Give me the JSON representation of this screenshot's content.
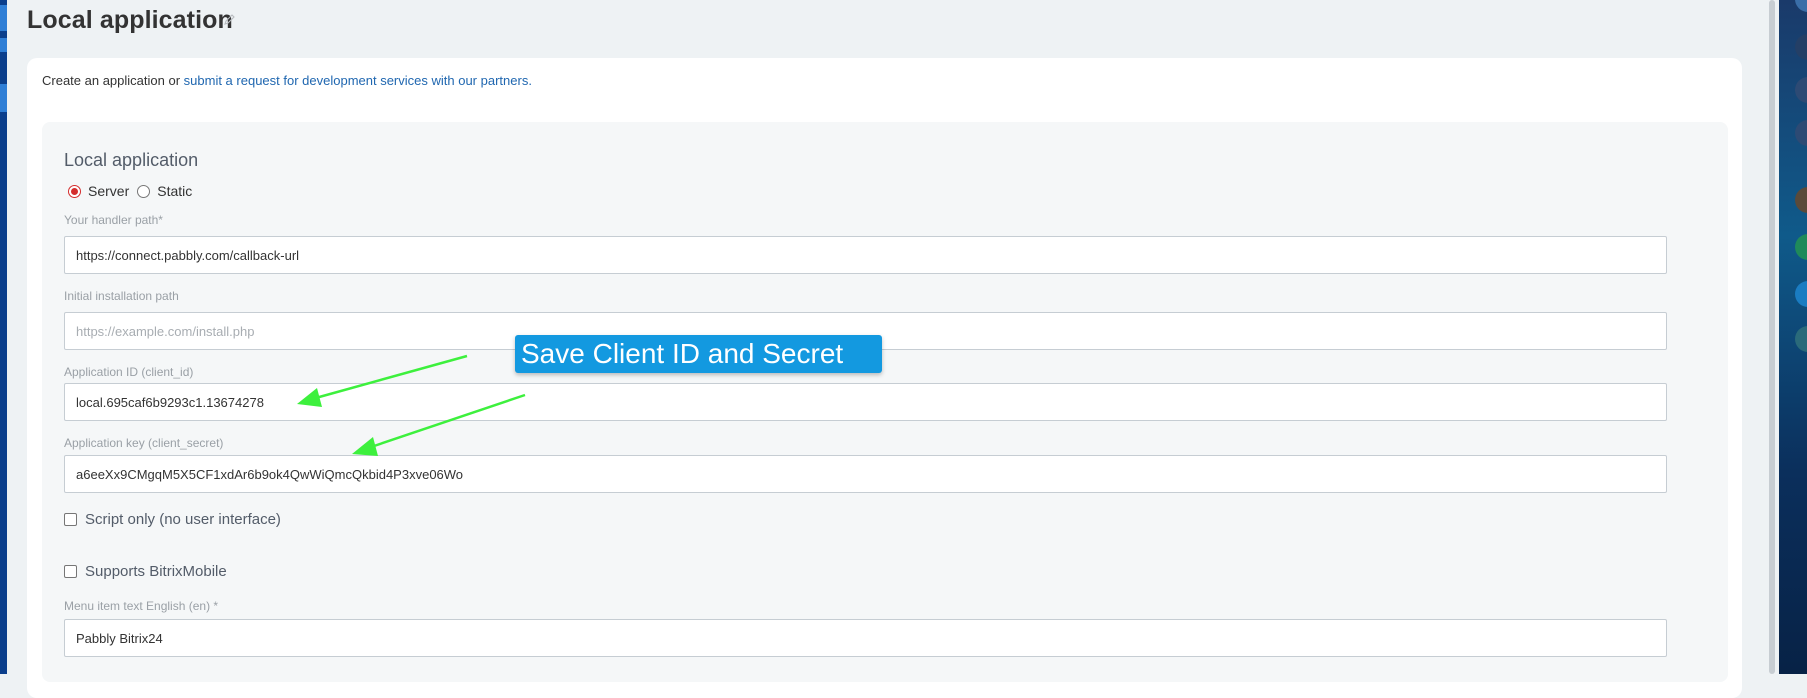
{
  "page": {
    "title": "Local application",
    "edit_icon": "pencil-icon"
  },
  "intro": {
    "prefix": "Create an application or ",
    "link": "submit a request for development services with our partners."
  },
  "form": {
    "section_title": "Local application",
    "type_options": [
      {
        "label": "Server",
        "checked": true
      },
      {
        "label": "Static",
        "checked": false
      }
    ],
    "handler_path": {
      "label": "Your handler path*",
      "value": "https://connect.pabbly.com/callback-url"
    },
    "install_path": {
      "label": "Initial installation path",
      "value": "",
      "placeholder": "https://example.com/install.php"
    },
    "client_id": {
      "label": "Application ID (client_id)",
      "value": "local.695caf6b9293c1.13674278"
    },
    "client_secret": {
      "label": "Application key (client_secret)",
      "value": "a6eeXx9CMgqM5X5CF1xdAr6b9ok4QwWiQmcQkbid4P3xve06Wo"
    },
    "script_only": {
      "label": "Script only (no user interface)",
      "checked": false
    },
    "bitrix_mobile": {
      "label": "Supports BitrixMobile",
      "checked": false
    },
    "menu_text_en": {
      "label": "Menu item text English (en) *",
      "value": "Pabbly Bitrix24"
    }
  },
  "annotation": {
    "callout_text": "Save Client ID and Secret",
    "arrow_color": "#3df03d",
    "callout_color": "#1399e0"
  },
  "colors": {
    "link": "#2067b0",
    "radio_accent": "#d42d2d",
    "background": "#eef2f4"
  }
}
